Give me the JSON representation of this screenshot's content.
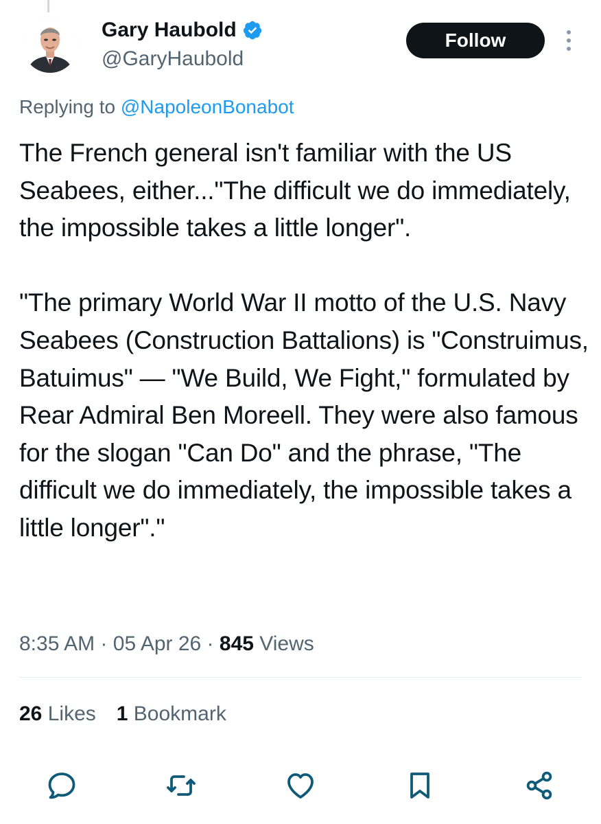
{
  "author": {
    "display_name": "Gary Haubold",
    "handle": "@GaryHaubold",
    "verified_icon": "verified-badge-icon"
  },
  "follow_label": "Follow",
  "reply_context": {
    "prefix": "Replying to ",
    "mention": "@NapoleonBonabot"
  },
  "tweet_text": "The French general isn't familiar with the US Seabees, either...\"The difficult we do immediately, the impossible takes a little longer\".\n\n\"The primary World War II motto of the U.S. Navy Seabees (Construction Battalions) is \"Construimus, Batuimus\" — \"We Build, We Fight,\" formulated by Rear Admiral Ben Moreell. They were also famous for the slogan \"Can Do\" and the phrase, \"The difficult we do immediately, the impossible takes a little longer\".\"",
  "meta": {
    "time": "8:35 AM",
    "date": "05 Apr 26",
    "views_count": "845",
    "views_label": "Views",
    "separator": "·"
  },
  "engagement": {
    "likes_count": "26",
    "likes_label": "Likes",
    "bookmarks_count": "1",
    "bookmarks_label": "Bookmark"
  },
  "actions": [
    "reply-icon",
    "retweet-icon",
    "like-icon",
    "bookmark-icon",
    "share-icon"
  ],
  "colors": {
    "text": "#0f1419",
    "secondary": "#536471",
    "link": "#1d9bf0",
    "verified": "#1d9bf0",
    "button_bg": "#0f1419",
    "button_text": "#ffffff"
  }
}
